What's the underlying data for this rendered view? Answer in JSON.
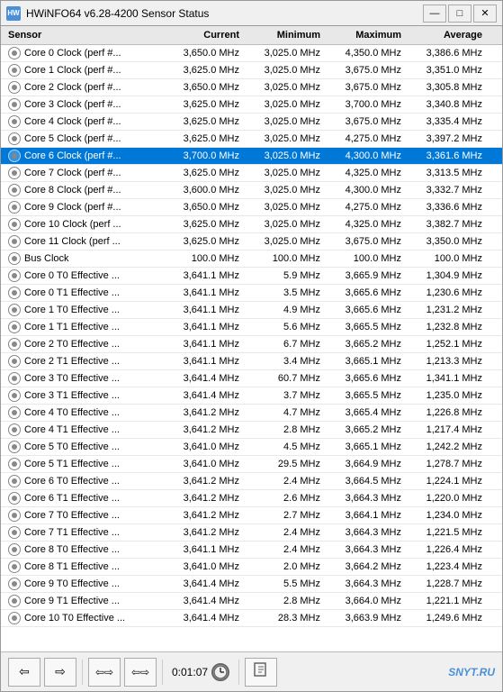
{
  "window": {
    "title": "HWiNFO64 v6.28-4200 Sensor Status",
    "icon_label": "HW"
  },
  "table": {
    "headers": [
      "Sensor",
      "Current",
      "Minimum",
      "Maximum",
      "Average"
    ],
    "rows": [
      {
        "name": "Core 0 Clock (perf #...",
        "current": "3,650.0 MHz",
        "minimum": "3,025.0 MHz",
        "maximum": "4,350.0 MHz",
        "average": "3,386.6 MHz",
        "highlighted": false
      },
      {
        "name": "Core 1 Clock (perf #...",
        "current": "3,625.0 MHz",
        "minimum": "3,025.0 MHz",
        "maximum": "3,675.0 MHz",
        "average": "3,351.0 MHz",
        "highlighted": false
      },
      {
        "name": "Core 2 Clock (perf #...",
        "current": "3,650.0 MHz",
        "minimum": "3,025.0 MHz",
        "maximum": "3,675.0 MHz",
        "average": "3,305.8 MHz",
        "highlighted": false
      },
      {
        "name": "Core 3 Clock (perf #...",
        "current": "3,625.0 MHz",
        "minimum": "3,025.0 MHz",
        "maximum": "3,700.0 MHz",
        "average": "3,340.8 MHz",
        "highlighted": false
      },
      {
        "name": "Core 4 Clock (perf #...",
        "current": "3,625.0 MHz",
        "minimum": "3,025.0 MHz",
        "maximum": "3,675.0 MHz",
        "average": "3,335.4 MHz",
        "highlighted": false
      },
      {
        "name": "Core 5 Clock (perf #...",
        "current": "3,625.0 MHz",
        "minimum": "3,025.0 MHz",
        "maximum": "4,275.0 MHz",
        "average": "3,397.2 MHz",
        "highlighted": false
      },
      {
        "name": "Core 6 Clock (perf #...",
        "current": "3,700.0 MHz",
        "minimum": "3,025.0 MHz",
        "maximum": "4,300.0 MHz",
        "average": "3,361.6 MHz",
        "highlighted": true
      },
      {
        "name": "Core 7 Clock (perf #...",
        "current": "3,625.0 MHz",
        "minimum": "3,025.0 MHz",
        "maximum": "4,325.0 MHz",
        "average": "3,313.5 MHz",
        "highlighted": false
      },
      {
        "name": "Core 8 Clock (perf #...",
        "current": "3,600.0 MHz",
        "minimum": "3,025.0 MHz",
        "maximum": "4,300.0 MHz",
        "average": "3,332.7 MHz",
        "highlighted": false
      },
      {
        "name": "Core 9 Clock (perf #...",
        "current": "3,650.0 MHz",
        "minimum": "3,025.0 MHz",
        "maximum": "4,275.0 MHz",
        "average": "3,336.6 MHz",
        "highlighted": false
      },
      {
        "name": "Core 10 Clock (perf ...",
        "current": "3,625.0 MHz",
        "minimum": "3,025.0 MHz",
        "maximum": "4,325.0 MHz",
        "average": "3,382.7 MHz",
        "highlighted": false
      },
      {
        "name": "Core 11 Clock (perf ...",
        "current": "3,625.0 MHz",
        "minimum": "3,025.0 MHz",
        "maximum": "3,675.0 MHz",
        "average": "3,350.0 MHz",
        "highlighted": false
      },
      {
        "name": "Bus Clock",
        "current": "100.0 MHz",
        "minimum": "100.0 MHz",
        "maximum": "100.0 MHz",
        "average": "100.0 MHz",
        "highlighted": false
      },
      {
        "name": "Core 0 T0 Effective ...",
        "current": "3,641.1 MHz",
        "minimum": "5.9 MHz",
        "maximum": "3,665.9 MHz",
        "average": "1,304.9 MHz",
        "highlighted": false
      },
      {
        "name": "Core 0 T1 Effective ...",
        "current": "3,641.1 MHz",
        "minimum": "3.5 MHz",
        "maximum": "3,665.6 MHz",
        "average": "1,230.6 MHz",
        "highlighted": false
      },
      {
        "name": "Core 1 T0 Effective ...",
        "current": "3,641.1 MHz",
        "minimum": "4.9 MHz",
        "maximum": "3,665.6 MHz",
        "average": "1,231.2 MHz",
        "highlighted": false
      },
      {
        "name": "Core 1 T1 Effective ...",
        "current": "3,641.1 MHz",
        "minimum": "5.6 MHz",
        "maximum": "3,665.5 MHz",
        "average": "1,232.8 MHz",
        "highlighted": false
      },
      {
        "name": "Core 2 T0 Effective ...",
        "current": "3,641.1 MHz",
        "minimum": "6.7 MHz",
        "maximum": "3,665.2 MHz",
        "average": "1,252.1 MHz",
        "highlighted": false
      },
      {
        "name": "Core 2 T1 Effective ...",
        "current": "3,641.1 MHz",
        "minimum": "3.4 MHz",
        "maximum": "3,665.1 MHz",
        "average": "1,213.3 MHz",
        "highlighted": false
      },
      {
        "name": "Core 3 T0 Effective ...",
        "current": "3,641.4 MHz",
        "minimum": "60.7 MHz",
        "maximum": "3,665.6 MHz",
        "average": "1,341.1 MHz",
        "highlighted": false
      },
      {
        "name": "Core 3 T1 Effective ...",
        "current": "3,641.4 MHz",
        "minimum": "3.7 MHz",
        "maximum": "3,665.5 MHz",
        "average": "1,235.0 MHz",
        "highlighted": false
      },
      {
        "name": "Core 4 T0 Effective ...",
        "current": "3,641.2 MHz",
        "minimum": "4.7 MHz",
        "maximum": "3,665.4 MHz",
        "average": "1,226.8 MHz",
        "highlighted": false
      },
      {
        "name": "Core 4 T1 Effective ...",
        "current": "3,641.2 MHz",
        "minimum": "2.8 MHz",
        "maximum": "3,665.2 MHz",
        "average": "1,217.4 MHz",
        "highlighted": false
      },
      {
        "name": "Core 5 T0 Effective ...",
        "current": "3,641.0 MHz",
        "minimum": "4.5 MHz",
        "maximum": "3,665.1 MHz",
        "average": "1,242.2 MHz",
        "highlighted": false
      },
      {
        "name": "Core 5 T1 Effective ...",
        "current": "3,641.0 MHz",
        "minimum": "29.5 MHz",
        "maximum": "3,664.9 MHz",
        "average": "1,278.7 MHz",
        "highlighted": false
      },
      {
        "name": "Core 6 T0 Effective ...",
        "current": "3,641.2 MHz",
        "minimum": "2.4 MHz",
        "maximum": "3,664.5 MHz",
        "average": "1,224.1 MHz",
        "highlighted": false
      },
      {
        "name": "Core 6 T1 Effective ...",
        "current": "3,641.2 MHz",
        "minimum": "2.6 MHz",
        "maximum": "3,664.3 MHz",
        "average": "1,220.0 MHz",
        "highlighted": false
      },
      {
        "name": "Core 7 T0 Effective ...",
        "current": "3,641.2 MHz",
        "minimum": "2.7 MHz",
        "maximum": "3,664.1 MHz",
        "average": "1,234.0 MHz",
        "highlighted": false
      },
      {
        "name": "Core 7 T1 Effective ...",
        "current": "3,641.2 MHz",
        "minimum": "2.4 MHz",
        "maximum": "3,664.3 MHz",
        "average": "1,221.5 MHz",
        "highlighted": false
      },
      {
        "name": "Core 8 T0 Effective ...",
        "current": "3,641.1 MHz",
        "minimum": "2.4 MHz",
        "maximum": "3,664.3 MHz",
        "average": "1,226.4 MHz",
        "highlighted": false
      },
      {
        "name": "Core 8 T1 Effective ...",
        "current": "3,641.0 MHz",
        "minimum": "2.0 MHz",
        "maximum": "3,664.2 MHz",
        "average": "1,223.4 MHz",
        "highlighted": false
      },
      {
        "name": "Core 9 T0 Effective ...",
        "current": "3,641.4 MHz",
        "minimum": "5.5 MHz",
        "maximum": "3,664.3 MHz",
        "average": "1,228.7 MHz",
        "highlighted": false
      },
      {
        "name": "Core 9 T1 Effective ...",
        "current": "3,641.4 MHz",
        "minimum": "2.8 MHz",
        "maximum": "3,664.0 MHz",
        "average": "1,221.1 MHz",
        "highlighted": false
      },
      {
        "name": "Core 10 T0 Effective ...",
        "current": "3,641.4 MHz",
        "minimum": "28.3 MHz",
        "maximum": "3,663.9 MHz",
        "average": "1,249.6 MHz",
        "highlighted": false
      }
    ]
  },
  "toolbar": {
    "back_label": "◄",
    "forward_label": "►",
    "nav_left": "◄►",
    "time": "0:01:07",
    "logo": "SNYT.RU"
  },
  "controls": {
    "minimize": "—",
    "maximize": "□",
    "close": "✕"
  }
}
